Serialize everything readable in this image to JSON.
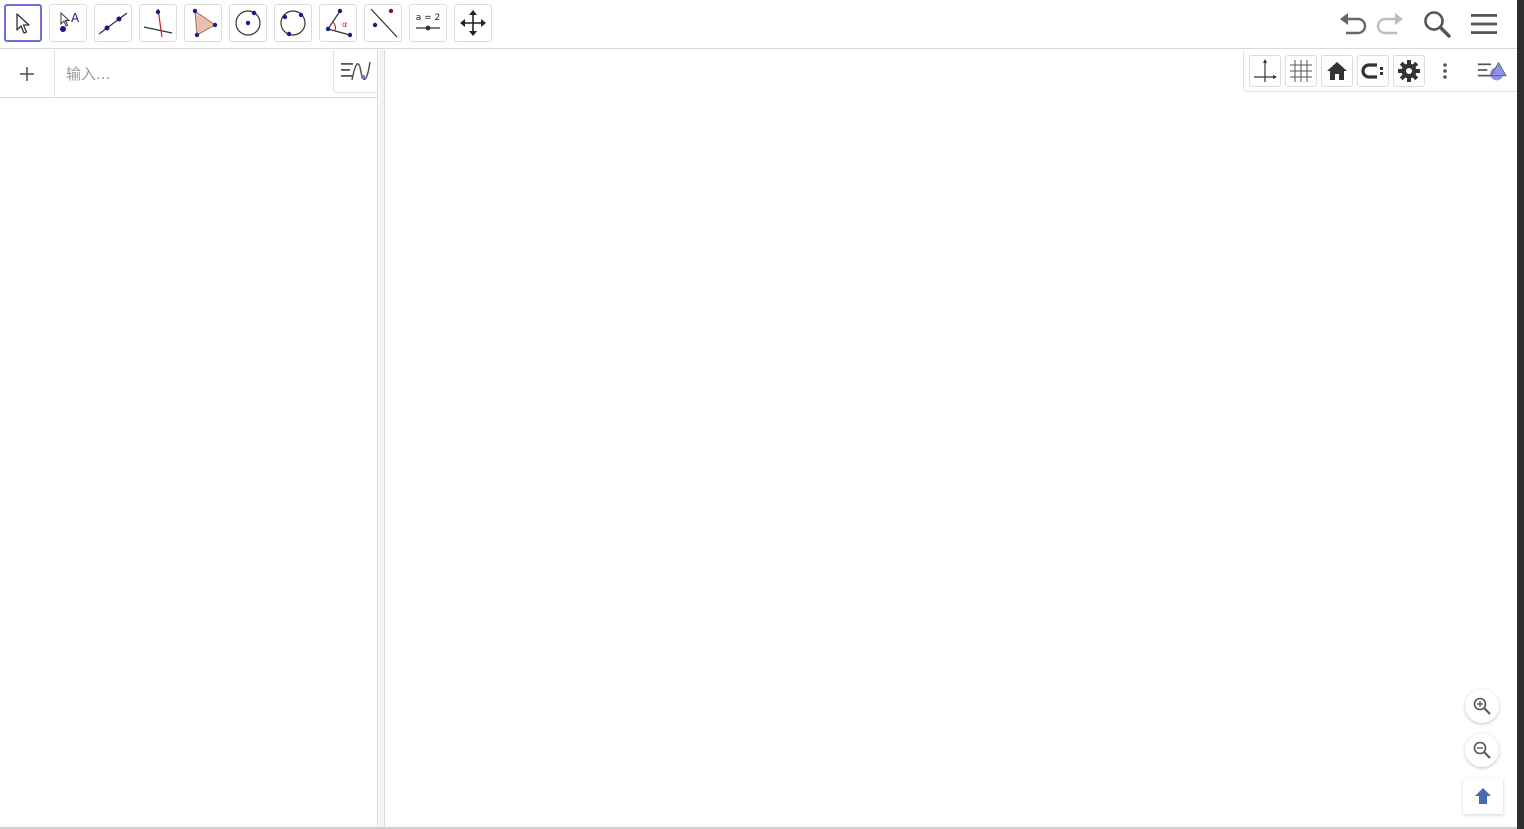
{
  "toolbar": {
    "tools": [
      {
        "name": "move-tool",
        "icon": "cursor-arrow-icon"
      },
      {
        "name": "point-tool",
        "icon": "point-label-icon",
        "label_text": "A"
      },
      {
        "name": "line-tool",
        "icon": "line-two-points-icon"
      },
      {
        "name": "perpendicular-line-tool",
        "icon": "perpendicular-line-icon"
      },
      {
        "name": "polygon-tool",
        "icon": "polygon-icon"
      },
      {
        "name": "circle-center-point-tool",
        "icon": "circle-center-point-icon"
      },
      {
        "name": "circle-three-points-tool",
        "icon": "circle-three-points-icon"
      },
      {
        "name": "angle-tool",
        "icon": "angle-icon",
        "label_text": "α"
      },
      {
        "name": "reflect-tool",
        "icon": "reflect-about-line-icon"
      },
      {
        "name": "slider-tool",
        "icon": "slider-icon",
        "label_text": "a = 2"
      },
      {
        "name": "move-graphics-view-tool",
        "icon": "move-cross-arrows-icon"
      }
    ],
    "selected_tool": "move-tool",
    "right_icons": [
      "undo-icon",
      "redo-icon",
      "search-icon",
      "hamburger-menu-icon"
    ]
  },
  "algebra": {
    "input_placeholder": "输入...",
    "add_icon": "plus-icon",
    "menu_icon": "algebra-settings-icon"
  },
  "graphics": {
    "style_bar_icons": [
      "axes-icon",
      "grid-icon",
      "home-icon",
      "capture-style-icon",
      "gear-icon",
      "more-vertical-icon",
      "toggle-style-bar-icon"
    ],
    "zoom_icons": [
      "zoom-in-icon",
      "zoom-out-icon",
      "standard-view-icon"
    ]
  },
  "colors": {
    "accent": "#6c6fd8",
    "point": "#1a1a8c",
    "polygon_fill": "#e8c1b0",
    "red": "#d02020"
  }
}
